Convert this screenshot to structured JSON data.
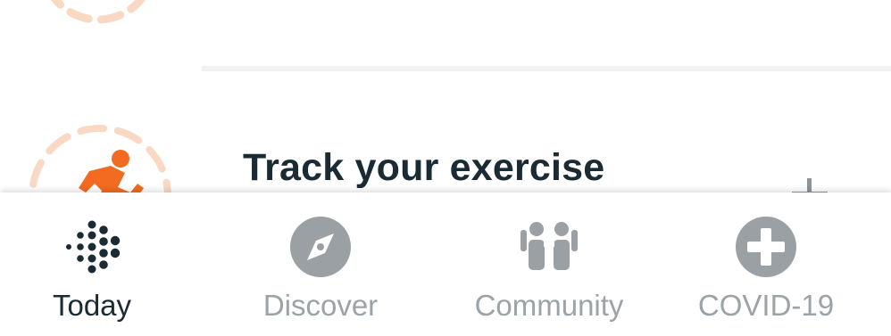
{
  "card": {
    "title": "Track your exercise"
  },
  "bottom_nav": {
    "items": [
      {
        "label": "Today",
        "icon": "fitbit-logo-icon",
        "active": true
      },
      {
        "label": "Discover",
        "icon": "compass-icon",
        "active": false
      },
      {
        "label": "Community",
        "icon": "community-icon",
        "active": false
      },
      {
        "label": "COVID-19",
        "icon": "plus-cross-icon",
        "active": false
      }
    ]
  },
  "colors": {
    "accent": "#f26b21",
    "ring": "#f9d9c4",
    "text_dark": "#1b2b33",
    "nav_inactive": "#9ca3a7",
    "icon_gray": "#9aa0a4"
  }
}
